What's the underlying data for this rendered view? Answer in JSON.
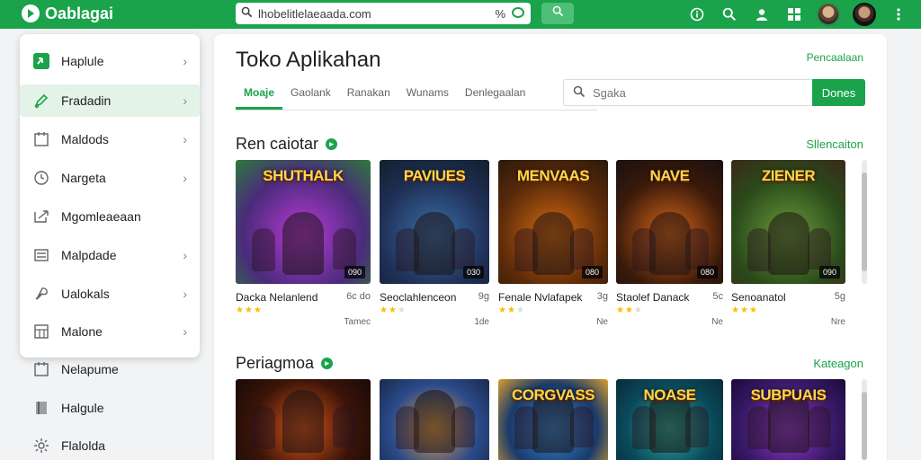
{
  "app": {
    "brand": "Oablagai"
  },
  "topbar": {
    "url": "lhobelitlelaeaada.com",
    "url_suffix": "%"
  },
  "sidebar": {
    "items": [
      {
        "label": "Haplule",
        "icon": "app-tile-icon",
        "chevron": true,
        "active": false
      },
      {
        "label": "Fradadin",
        "icon": "pen-icon",
        "chevron": true,
        "active": true
      },
      {
        "label": "Maldods",
        "icon": "calendar-icon",
        "chevron": true,
        "active": false
      },
      {
        "label": "Nargeta",
        "icon": "clock-icon",
        "chevron": true,
        "active": false
      },
      {
        "label": "Mgomleaeaan",
        "icon": "send-icon",
        "chevron": false,
        "active": false
      },
      {
        "label": "Malpdade",
        "icon": "list-icon",
        "chevron": true,
        "active": false
      },
      {
        "label": "Ualokals",
        "icon": "wrench-icon",
        "chevron": true,
        "active": false
      },
      {
        "label": "Malone",
        "icon": "grid-icon",
        "chevron": true,
        "active": false
      },
      {
        "label": "Nelapume",
        "icon": "calendar-icon",
        "chevron": false,
        "active": false
      },
      {
        "label": "Halgule",
        "icon": "book-icon",
        "chevron": false,
        "active": false
      },
      {
        "label": "Flalolda",
        "icon": "gear-icon",
        "chevron": false,
        "active": false
      }
    ]
  },
  "main": {
    "title": "Toko Aplikahan",
    "top_link": "Pencaalaan",
    "tabs": [
      "Moaje",
      "Gaolank",
      "Ranakan",
      "Wunams",
      "Denlegaalan"
    ],
    "search_placeholder": "Sgaka",
    "done_label": "Dones",
    "sections": [
      {
        "title": "Ren caiotar",
        "link": "Sllencaiton",
        "games": [
          {
            "logo": "SHUTHALK",
            "name": "Dacka Nelanlend",
            "size": "6c do",
            "rating": 2.5,
            "meta": "Tamec",
            "tag": "090",
            "colors": [
              "#4a2b7a",
              "#b83ad6",
              "#2d7a3a"
            ]
          },
          {
            "logo": "PAVIUES",
            "name": "Seoclahlenceon",
            "size": "9g",
            "rating": 2,
            "meta": "1de",
            "tag": "030",
            "colors": [
              "#1f2f55",
              "#3a6fa8",
              "#12202c"
            ]
          },
          {
            "logo": "MENVAAS",
            "name": "Fenale Nvlafapek",
            "size": "3g",
            "rating": 2,
            "meta": "Ne",
            "tag": "080",
            "colors": [
              "#5a2a0a",
              "#d66a10",
              "#2a1a0a"
            ]
          },
          {
            "logo": "NAVE",
            "name": "Staolef Danack",
            "size": "5c",
            "rating": 2,
            "meta": "Ne",
            "tag": "080",
            "colors": [
              "#3a1a0a",
              "#d8651a",
              "#1a1010"
            ]
          },
          {
            "logo": "ZIENER",
            "name": "Senoanatol",
            "size": "5g",
            "rating": 3,
            "meta": "Nre",
            "tag": "090",
            "colors": [
              "#2a4a1a",
              "#6a9a3a",
              "#3a2a1a"
            ]
          }
        ]
      },
      {
        "title": "Periagmoa",
        "link": "Kateagon",
        "games": [
          {
            "logo": "",
            "colors": [
              "#3a1408",
              "#d8551a",
              "#1a0a08"
            ]
          },
          {
            "logo": "",
            "colors": [
              "#2a4a8a",
              "#e8a040",
              "#1a2a4a"
            ]
          },
          {
            "logo": "CORGVASS",
            "colors": [
              "#1a3a6a",
              "#3a8ad6",
              "#d8a030"
            ]
          },
          {
            "logo": "NOASE",
            "colors": [
              "#0a4a5a",
              "#30b0a0",
              "#0a2a3a"
            ]
          },
          {
            "logo": "SUBPUAIS",
            "colors": [
              "#3a1a6a",
              "#9a3ad6",
              "#1a0a3a"
            ]
          }
        ]
      }
    ]
  },
  "colors": {
    "accent": "#1aa34a",
    "star": "#fbbc04"
  }
}
